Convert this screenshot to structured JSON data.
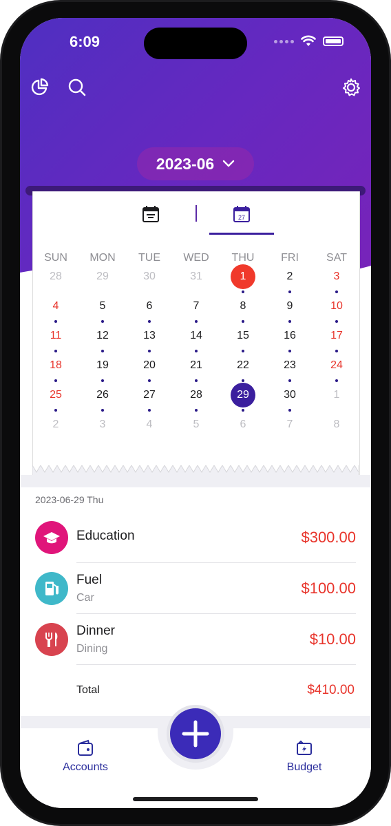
{
  "status": {
    "time": "6:09"
  },
  "header": {
    "month": "2023-06"
  },
  "calendar": {
    "weekdays": [
      "SUN",
      "MON",
      "TUE",
      "WED",
      "THU",
      "FRI",
      "SAT"
    ],
    "weeks": [
      [
        "28",
        "29",
        "30",
        "31",
        "1",
        "2",
        "3"
      ],
      [
        "4",
        "5",
        "6",
        "7",
        "8",
        "9",
        "10"
      ],
      [
        "11",
        "12",
        "13",
        "14",
        "15",
        "16",
        "17"
      ],
      [
        "18",
        "19",
        "20",
        "21",
        "22",
        "23",
        "24"
      ],
      [
        "25",
        "26",
        "27",
        "28",
        "29",
        "30",
        "1"
      ],
      [
        "2",
        "3",
        "4",
        "5",
        "6",
        "7",
        "8"
      ]
    ],
    "today": "1",
    "selected": "29"
  },
  "day_detail": {
    "date_label": "2023-06-29 Thu",
    "entries": [
      {
        "name": "Education",
        "sub": "",
        "amount": "$300.00",
        "icon": "graduation-cap-icon",
        "color": "#e0157a"
      },
      {
        "name": "Fuel",
        "sub": "Car",
        "amount": "$100.00",
        "icon": "fuel-pump-icon",
        "color": "#3fb8c9"
      },
      {
        "name": "Dinner",
        "sub": "Dining",
        "amount": "$10.00",
        "icon": "fork-knife-icon",
        "color": "#d8434f"
      }
    ],
    "total_label": "Total",
    "total_amount": "$410.00"
  },
  "tabbar": {
    "accounts": "Accounts",
    "budget": "Budget"
  },
  "colors": {
    "accent": "#3b1f9e",
    "expense": "#e8342b",
    "hero_start": "#4f2fc1",
    "hero_end": "#7a23b8"
  }
}
